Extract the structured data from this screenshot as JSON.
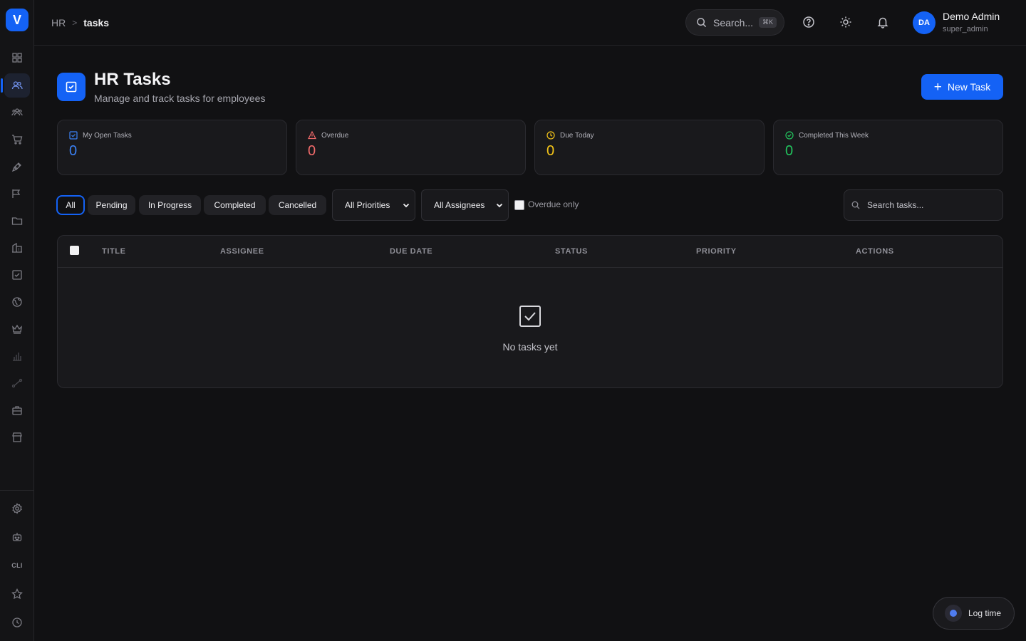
{
  "app": {
    "logo_letter": "V"
  },
  "breadcrumb": {
    "root": "HR",
    "separator": ">",
    "current": "tasks"
  },
  "topbar": {
    "search_label": "Search...",
    "search_shortcut": "⌘K",
    "user": {
      "initials": "DA",
      "name": "Demo Admin",
      "role": "super_admin"
    }
  },
  "sidebar": {
    "bottom_items": {
      "cli_label": "CLI"
    }
  },
  "header": {
    "title": "HR Tasks",
    "subtitle": "Manage and track tasks for employees",
    "new_task_label": "New Task"
  },
  "stats": [
    {
      "label": "My Open Tasks",
      "value": "0",
      "color": "#3b82f6"
    },
    {
      "label": "Overdue",
      "value": "0",
      "color": "#f06a6a"
    },
    {
      "label": "Due Today",
      "value": "0",
      "color": "#f5c518"
    },
    {
      "label": "Completed This Week",
      "value": "0",
      "color": "#22c55e"
    }
  ],
  "filters": {
    "tabs": [
      "All",
      "Pending",
      "In Progress",
      "Completed",
      "Cancelled"
    ],
    "active_tab": "All",
    "priority_select": "All Priorities",
    "assignee_select": "All Assignees",
    "overdue_only_label": "Overdue only",
    "search_placeholder": "Search tasks..."
  },
  "table": {
    "columns": [
      "TITLE",
      "ASSIGNEE",
      "DUE DATE",
      "STATUS",
      "PRIORITY",
      "ACTIONS"
    ],
    "empty_message": "No tasks yet"
  },
  "log_time": {
    "label": "Log time"
  },
  "colors": {
    "accent": "#1462f5",
    "background": "#111113",
    "card": "#19191c"
  }
}
